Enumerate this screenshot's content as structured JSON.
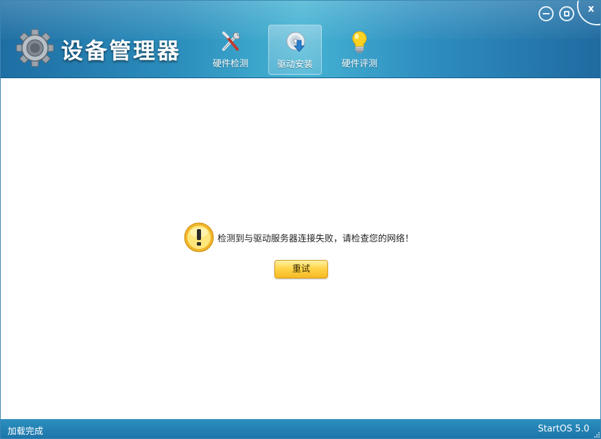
{
  "app": {
    "title": "设备管理器"
  },
  "tabs": [
    {
      "label": "硬件检测",
      "icon": "tools-icon",
      "active": false
    },
    {
      "label": "驱动安装",
      "icon": "driver-disc-icon",
      "active": true
    },
    {
      "label": "硬件评测",
      "icon": "lightbulb-icon",
      "active": false
    }
  ],
  "window_controls": {
    "minimize": "minimize-icon",
    "maximize": "maximize-icon",
    "close": "x"
  },
  "main": {
    "message": "检测到与驱动服务器连接失败，请检查您的网络！",
    "retry_label": "重试",
    "icon": "warning-icon"
  },
  "statusbar": {
    "status": "加载完成",
    "version": "StartOS 5.0"
  },
  "colors": {
    "header": "#2c8fbd",
    "accent_button": "#ffd54a",
    "statusbar": "#1c73a8"
  }
}
